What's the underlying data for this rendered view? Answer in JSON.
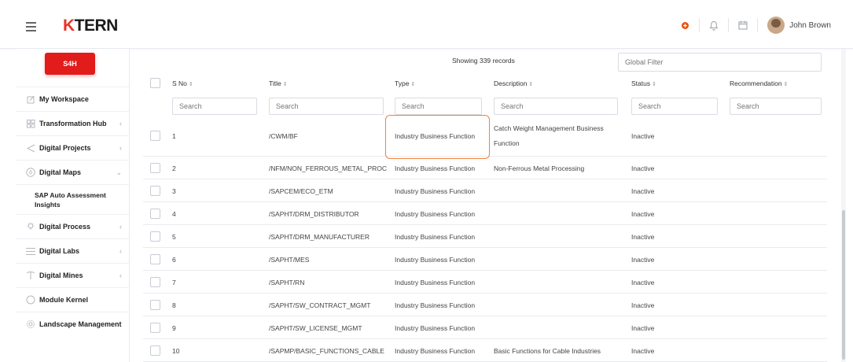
{
  "header": {
    "logo_prefix": "K",
    "logo_suffix": "TERN",
    "user_name": "John Brown"
  },
  "sidebar": {
    "tenant_badge": "S4H",
    "items": [
      {
        "label": "My Workspace",
        "icon": "workspace-icon",
        "chevron": false
      },
      {
        "label": "Transformation Hub",
        "icon": "grid-icon",
        "chevron": true
      },
      {
        "label": "Digital Projects",
        "icon": "send-icon",
        "chevron": true
      },
      {
        "label": "Digital Maps",
        "icon": "map-icon",
        "chevron": true,
        "expanded": true
      },
      {
        "label": "SAP Auto Assessment Insights",
        "sub": true
      },
      {
        "label": "Digital Process",
        "icon": "bulb-icon",
        "chevron": true
      },
      {
        "label": "Digital Labs",
        "icon": "list-icon",
        "chevron": true
      },
      {
        "label": "Digital Mines",
        "icon": "pickaxe-icon",
        "chevron": true
      },
      {
        "label": "Module Kernel",
        "icon": "circle-icon",
        "chevron": false
      },
      {
        "label": "Landscape Management",
        "icon": "gear-icon",
        "chevron": false
      }
    ]
  },
  "table": {
    "showing": "Showing 339 records",
    "global_filter_placeholder": "Global Filter",
    "search_placeholder": "Search",
    "columns": [
      "S No",
      "Title",
      "Type",
      "Description",
      "Status",
      "Recommendation"
    ],
    "rows": [
      {
        "sno": "1",
        "title": "/CWM/BF",
        "type": "Industry Business Function",
        "description_1": "Catch Weight Management Business",
        "description_2": "Function",
        "status": "Inactive"
      },
      {
        "sno": "2",
        "title": "/NFM/NON_FERROUS_METAL_PROC",
        "type": "Industry Business Function",
        "description_1": "Non-Ferrous Metal Processing",
        "description_2": "",
        "status": "Inactive"
      },
      {
        "sno": "3",
        "title": "/SAPCEM/ECO_ETM",
        "type": "Industry Business Function",
        "description_1": "",
        "description_2": "",
        "status": "Inactive"
      },
      {
        "sno": "4",
        "title": "/SAPHT/DRM_DISTRIBUTOR",
        "type": "Industry Business Function",
        "description_1": "",
        "description_2": "",
        "status": "Inactive"
      },
      {
        "sno": "5",
        "title": "/SAPHT/DRM_MANUFACTURER",
        "type": "Industry Business Function",
        "description_1": "",
        "description_2": "",
        "status": "Inactive"
      },
      {
        "sno": "6",
        "title": "/SAPHT/MES",
        "type": "Industry Business Function",
        "description_1": "",
        "description_2": "",
        "status": "Inactive"
      },
      {
        "sno": "7",
        "title": "/SAPHT/RN",
        "type": "Industry Business Function",
        "description_1": "",
        "description_2": "",
        "status": "Inactive"
      },
      {
        "sno": "8",
        "title": "/SAPHT/SW_CONTRACT_MGMT",
        "type": "Industry Business Function",
        "description_1": "",
        "description_2": "",
        "status": "Inactive"
      },
      {
        "sno": "9",
        "title": "/SAPHT/SW_LICENSE_MGMT",
        "type": "Industry Business Function",
        "description_1": "",
        "description_2": "",
        "status": "Inactive"
      },
      {
        "sno": "10",
        "title": "/SAPMP/BASIC_FUNCTIONS_CABLE",
        "type": "Industry Business Function",
        "description_1": "Basic Functions for Cable Industries",
        "description_2": "",
        "status": "Inactive"
      }
    ]
  },
  "colors": {
    "brand_red": "#e21b1b",
    "highlight_orange": "#f0833c",
    "notify_orange": "#e8510a"
  }
}
